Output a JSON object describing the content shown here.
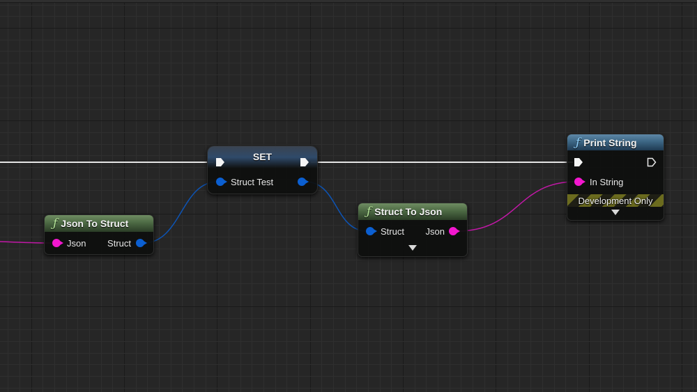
{
  "editor": {
    "type": "blueprint-graph",
    "colors": {
      "background": "#262626",
      "exec_wire": "#e6e6e6",
      "struct_pin": "#0b5fd1",
      "string_pin": "#f317cf",
      "function_header_green": "#4d6a44",
      "function_header_blue": "#3c6684"
    }
  },
  "nodes": {
    "set": {
      "title": "SET",
      "input_pin": "Struct Test"
    },
    "json_to_struct": {
      "icon": "function-icon",
      "title": "Json To Struct",
      "input_pin": "Json",
      "output_pin": "Struct"
    },
    "struct_to_json": {
      "icon": "function-icon",
      "title": "Struct To Json",
      "input_pin": "Struct",
      "output_pin": "Json"
    },
    "print_string": {
      "icon": "function-icon",
      "title": "Print String",
      "input_pin": "In String",
      "banner": "Development Only"
    }
  },
  "glyphs": {
    "function": "ƒ"
  }
}
